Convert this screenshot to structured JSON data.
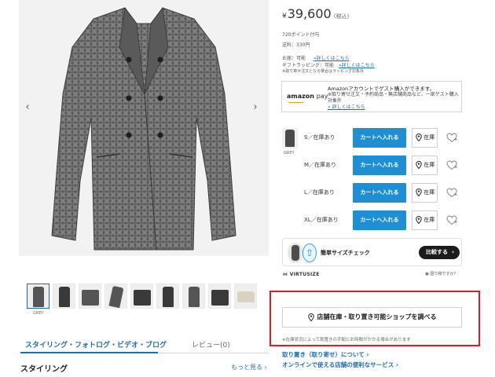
{
  "gallery": {
    "prev_arrow": "‹",
    "next_arrow": "›",
    "thumb_caption": "GREY",
    "thumbnails": [
      "coat-front",
      "coat-front-2",
      "coat-flat",
      "coat-detail",
      "coat-fabric",
      "coat-back",
      "coat-side",
      "coat-worn",
      "coat-tag"
    ]
  },
  "tabs": {
    "styling": "スタイリング・フォトログ・ビデオ・ブログ",
    "review": "レビュー(0)"
  },
  "styling_section": {
    "title": "スタイリング",
    "more": "もっと見る"
  },
  "product": {
    "currency": "¥",
    "price": "39,600",
    "tax": "(税込)",
    "points": "720ポイント付与",
    "shipping": "送料：330円",
    "gift": "お届：可能",
    "gift_link": "»詳しくはこちら",
    "wrapping": "ギフトラッピング：可能",
    "wrapping_link": "»詳しくはこちら",
    "wrapping_note": "※取り寄せ注文となる場合はラッピング対象外"
  },
  "amazon": {
    "logo_1": "amazon",
    "logo_2": "pay",
    "text": "Amazonアカウントでゲスト購入ができます。",
    "note": "※取り寄せ注文・予約商品・無店舗商品など、一部ゲスト購入対象外",
    "link": "» 詳しくはこちら"
  },
  "color": {
    "name": "GREY"
  },
  "sizes": [
    {
      "label": "S／在庫あり",
      "cart": "カートへ入れる",
      "store": "在庫"
    },
    {
      "label": "M／在庫あり",
      "cart": "カートへ入れる",
      "store": "在庫"
    },
    {
      "label": "L／在庫あり",
      "cart": "カートへ入れる",
      "store": "在庫"
    },
    {
      "label": "XL／在庫あり",
      "cart": "カートへ入れる",
      "store": "在庫"
    }
  ],
  "virtusize": {
    "label": "簡単サイズチェック",
    "button": "比較する",
    "chevron": "›",
    "brand": "VIRTUSIZE",
    "help": "困り物ですか?"
  },
  "store_search": {
    "button": "店舗在庫・取り置き可能ショップを調べる",
    "note": "※在庫状況によって取置きの手配にお時間がかかる場合があります"
  },
  "links": {
    "reserve": "取り置き（取り寄せ）について ›",
    "online": "オンラインで使える店舗の便利なサービス ›"
  },
  "colors": {
    "accent_blue": "#1d8fd2",
    "link_blue": "#1f6db5",
    "highlight_red": "#e01c24"
  }
}
